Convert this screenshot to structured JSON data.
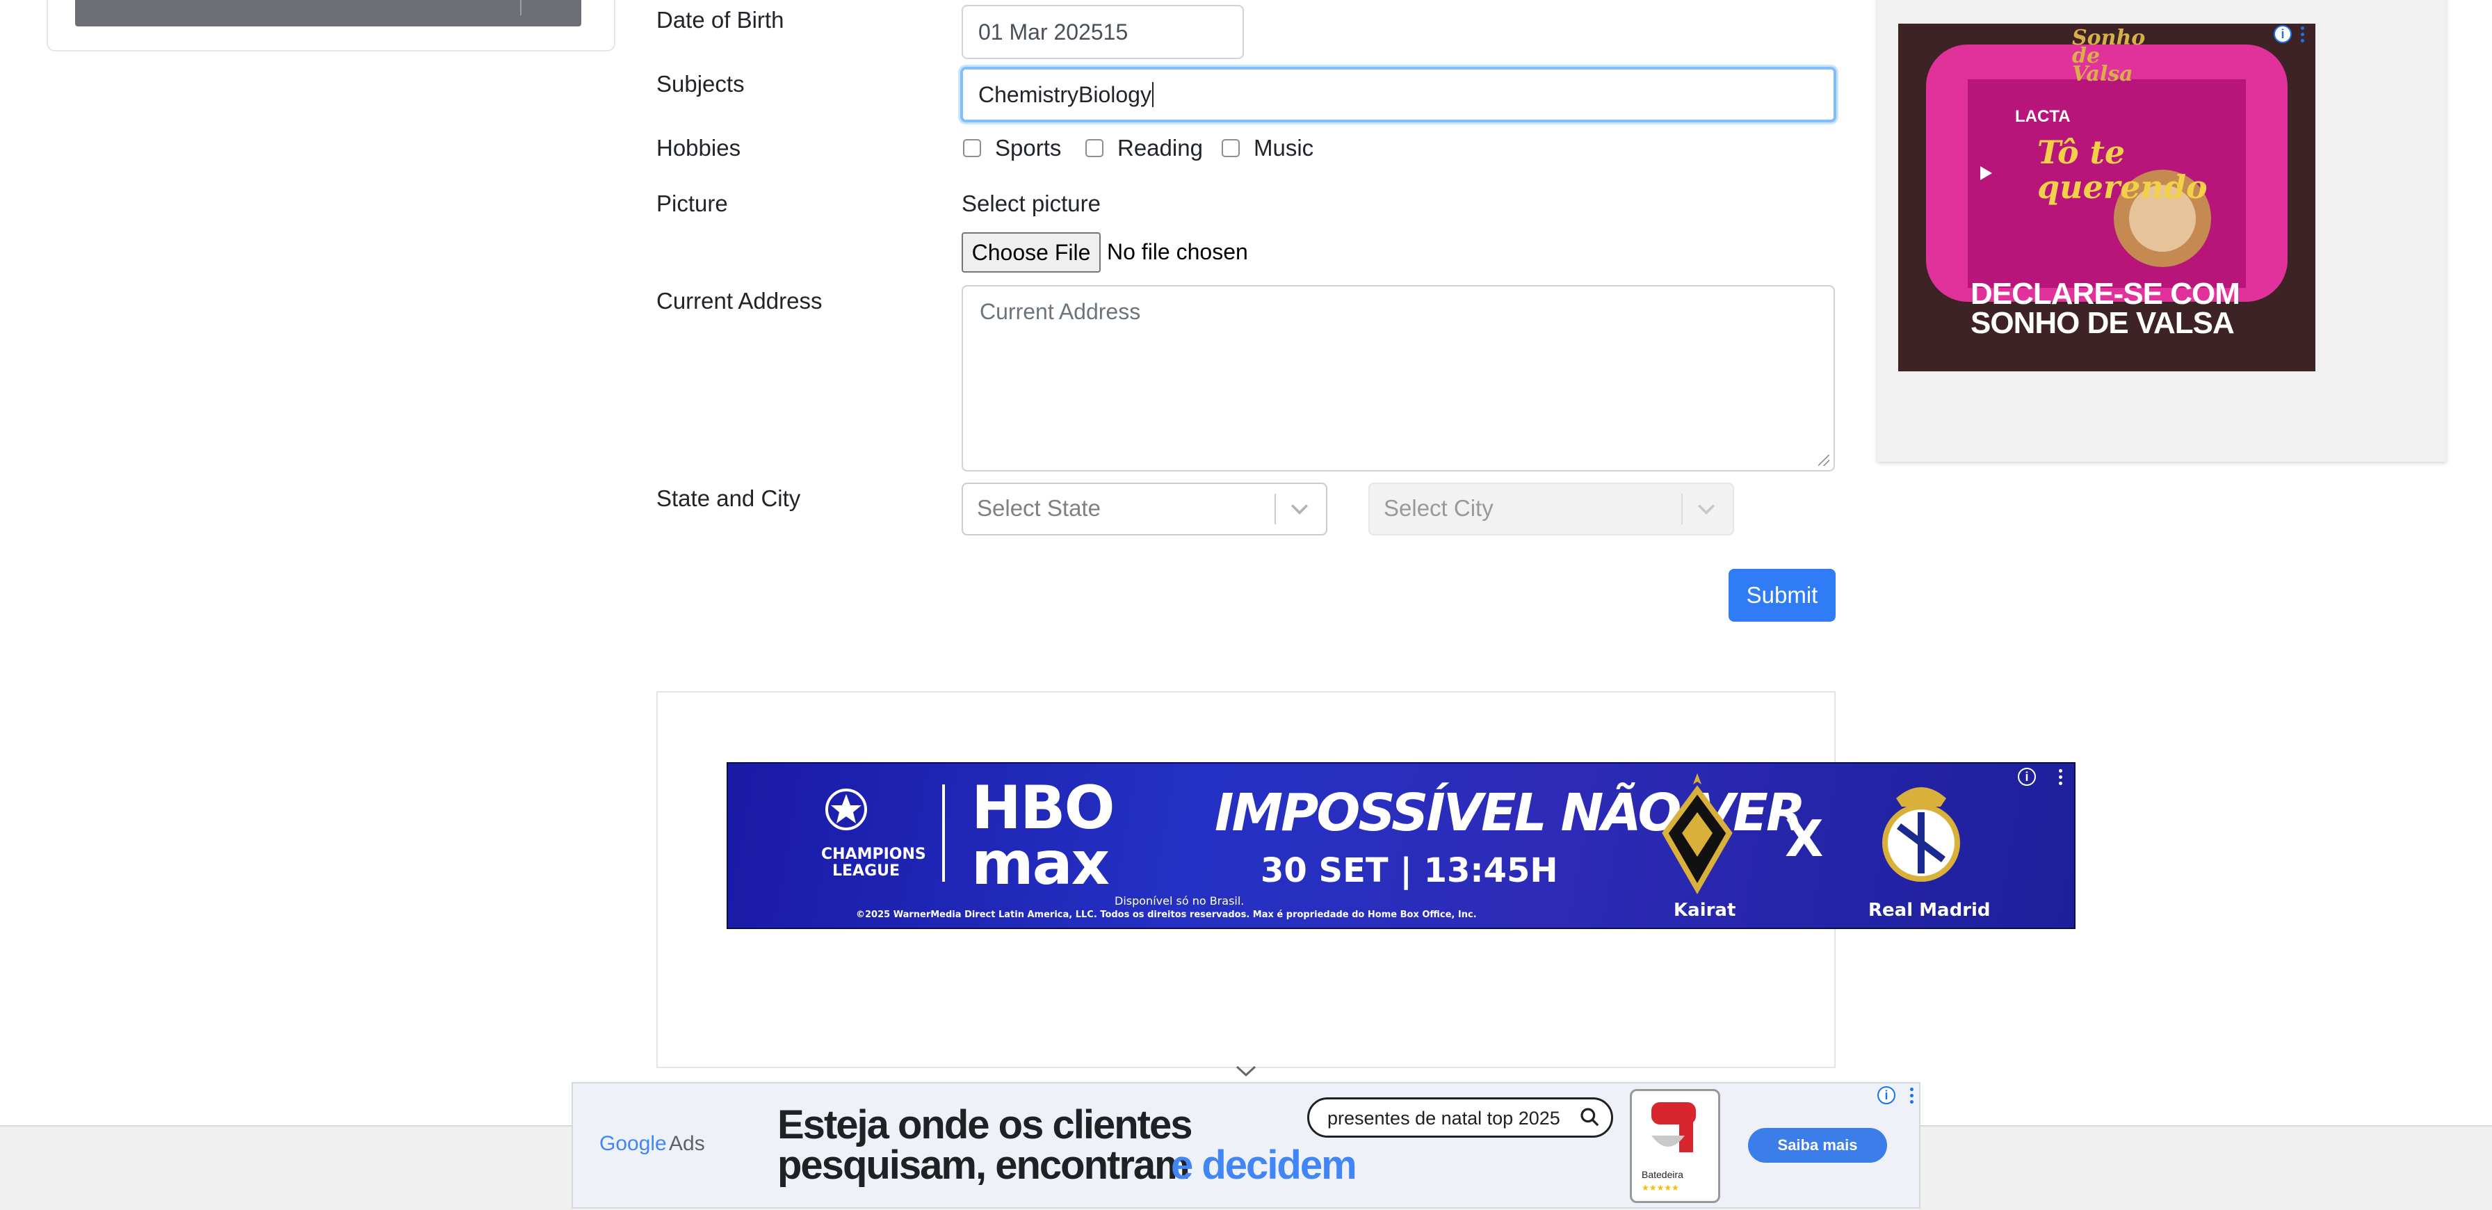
{
  "form": {
    "dob_label": "Date of Birth",
    "dob_value": "01 Mar 202515",
    "subjects_label": "Subjects",
    "subjects_value": "ChemistryBiology",
    "hobbies_label": "Hobbies",
    "hobbies": [
      {
        "label": "Sports",
        "checked": false
      },
      {
        "label": "Reading",
        "checked": false
      },
      {
        "label": "Music",
        "checked": false
      }
    ],
    "picture_label": "Picture",
    "select_picture": "Select picture",
    "choose_file": "Choose File",
    "no_file": "No file chosen",
    "address_label": "Current Address",
    "address_placeholder": "Current Address",
    "state_city_label": "State and City",
    "state_placeholder": "Select State",
    "city_placeholder": "Select City",
    "submit_label": "Submit"
  },
  "ads": {
    "hbo": {
      "league_line1": "CHAMPIONS",
      "league_line2": "LEAGUE",
      "brand_top": "HBO",
      "brand_bottom": "max",
      "headline": "IMPOSSÍVEL NÃO VER",
      "date": "30 SET | 13:45H",
      "avail": "Disponível só no Brasil.",
      "legal": "©2025 WarnerMedia Direct Latin America, LLC. Todos os direitos reservados. Max é propriedade do Home Box Office, Inc.",
      "team1": "Kairat",
      "versus": "X",
      "team2": "Real Madrid"
    },
    "sonho": {
      "brand": "Sonho de Valsa",
      "lacta": "LACTA",
      "product": "Tô te querendo",
      "headline1": "DECLARE-SE COM",
      "headline2": "SONHO DE VALSA"
    },
    "google": {
      "logo": "Google",
      "ads": "Ads",
      "line1": "Esteja onde os clientes",
      "line2a": "pesquisam, encontram",
      "line2b": "e decidem",
      "search": "presentes de natal top 2025",
      "card_label": "Batedeira",
      "cta": "Saiba mais"
    }
  },
  "colors": {
    "primary": "#2f7cf6",
    "focus": "#80bdff",
    "ad_blue": "#1a73e8",
    "sonho_pink": "#e0329a"
  }
}
